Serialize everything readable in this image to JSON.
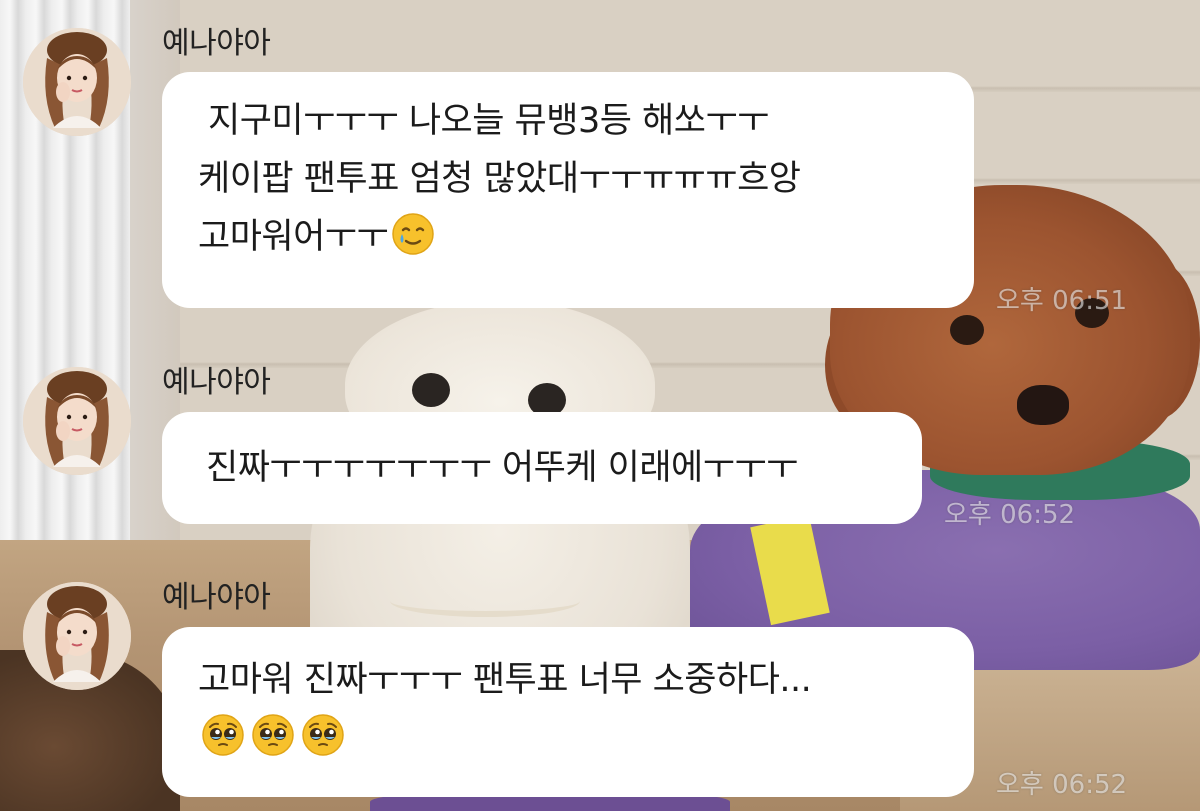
{
  "messages": [
    {
      "sender": "예나야아",
      "lines": [
        "지구미ㅜㅜㅜ 나오늘 뮤뱅3등 해쏘ㅜㅜ",
        "케이팝 팬투표 엄청 많았대ㅜㅜㅠㅠㅠ흐앙",
        "고마워어ㅜㅜ"
      ],
      "emoji": [
        "smiling-face-with-tear-emoji"
      ],
      "time": "오후 06:51"
    },
    {
      "sender": "예나야아",
      "lines": [
        "진짜ㅜㅜㅜㅜㅜㅜㅜ 어뚜케 이래에ㅜㅜㅜ"
      ],
      "emoji": [],
      "time": "오후 06:52"
    },
    {
      "sender": "예나야아",
      "lines": [
        "고마워 진짜ㅜㅜㅜ 팬투표 너무 소중하다..."
      ],
      "emoji": [
        "pleading-face-emoji",
        "pleading-face-emoji",
        "pleading-face-emoji"
      ],
      "time": "오후 06:52"
    }
  ],
  "colors": {
    "bubble": "#ffffff",
    "text": "#1b1b1b",
    "emoji_yellow": "#f7c12c"
  }
}
